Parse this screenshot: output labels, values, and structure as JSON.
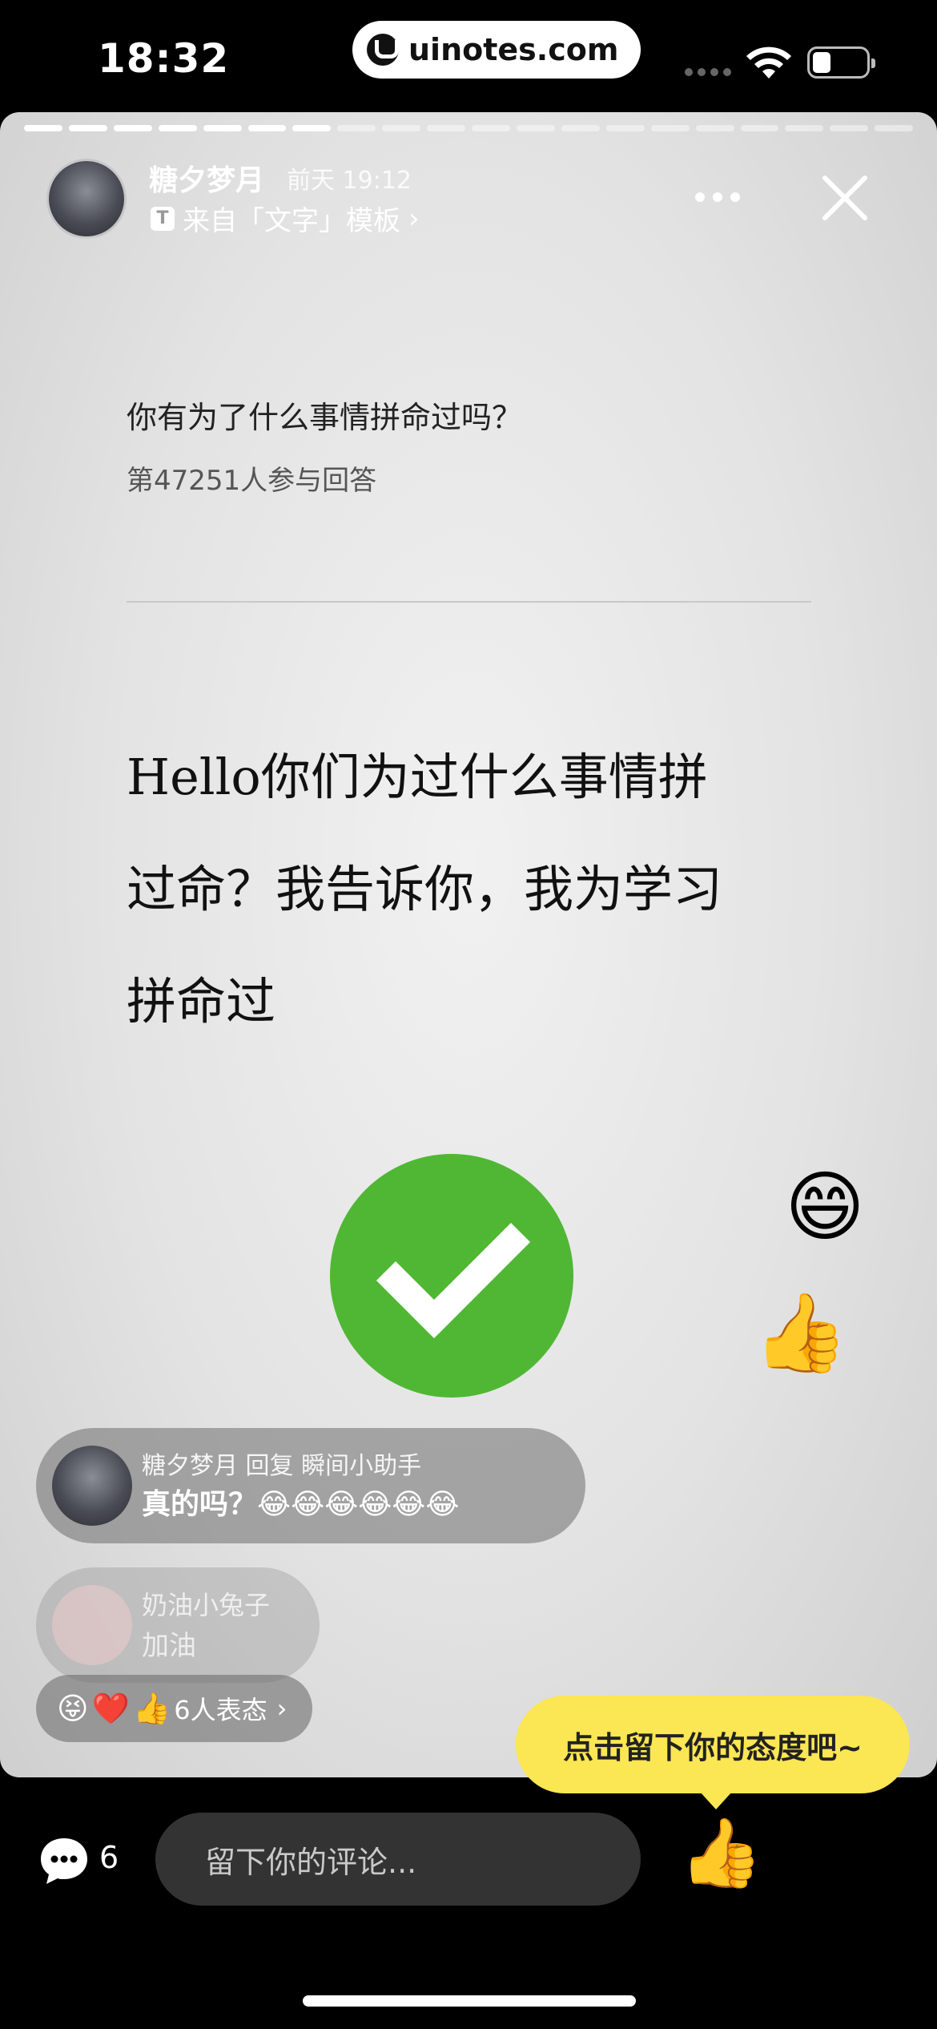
{
  "status_bar": {
    "time": "18:32",
    "site": "uinotes.com",
    "icons": [
      "signal-dots-icon",
      "wifi-icon",
      "battery-icon"
    ]
  },
  "story": {
    "progress": {
      "segments": 20,
      "completed": 7
    },
    "author": {
      "name": "糖夕梦月",
      "time": "前天 19:12"
    },
    "template_link": "来自「文字」模板",
    "question": "你有为了什么事情拼命过吗？",
    "participants": "第47251人参与回答",
    "answer_lines": [
      "Hello你们为过什么事情拼",
      "过命？我告诉你，我为学习",
      "拼命过"
    ]
  },
  "floating_reactions": [
    "😄",
    "👍"
  ],
  "comments": [
    {
      "meta": "糖夕梦月 回复 瞬间小助手",
      "text": "真的吗？😂😂😂😂😂😂"
    },
    {
      "meta": "奶油小兔子",
      "text": "加油"
    }
  ],
  "reactions_summary": {
    "emojis": [
      "😝",
      "❤️",
      "👍"
    ],
    "label": "6人表态"
  },
  "tooltip": "点击留下你的态度吧~",
  "bottom_bar": {
    "comment_count": "6",
    "input_placeholder": "留下你的评论...",
    "quick_reactions": [
      "👍",
      "😂",
      "😄"
    ]
  },
  "colors": {
    "check_green": "#4fb734",
    "tooltip_yellow": "#fbe653",
    "input_bg": "#333333"
  }
}
